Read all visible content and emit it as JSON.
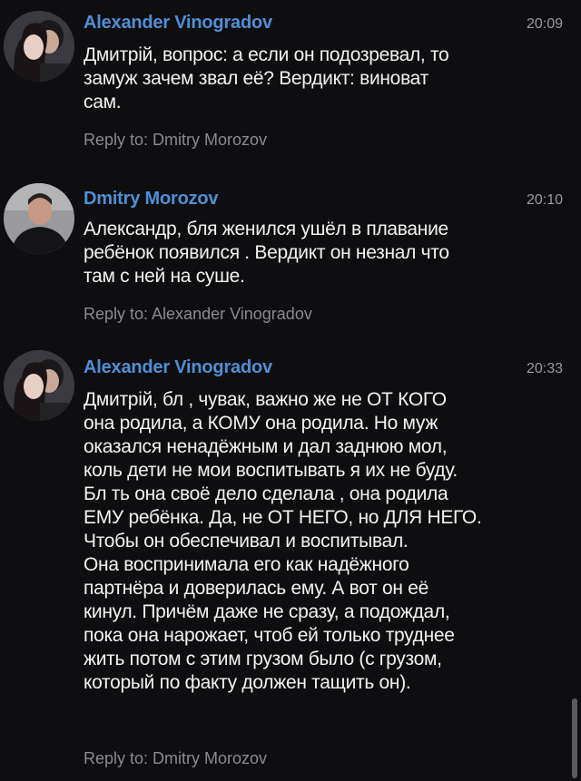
{
  "messages": [
    {
      "author": "Alexander Vinogradov",
      "time": "20:09",
      "avatar_icon": "couple-photo-avatar",
      "lines": [
        "Дмитрій, вопрос: а если он подозревал, то",
        "замуж зачем звал её? Вердикт: виноват",
        "сам."
      ],
      "reply": "Reply to: Dmitry Morozov"
    },
    {
      "author": "Dmitry Morozov",
      "time": "20:10",
      "avatar_icon": "man-photo-avatar",
      "lines": [
        "Александр,  бля женился  ушёл в плавание",
        "ребёнок появился . Вердикт он незнал что",
        "там с ней на суше."
      ],
      "reply": "Reply to: Alexander Vinogradov"
    },
    {
      "author": "Alexander Vinogradov",
      "time": "20:33",
      "avatar_icon": "couple-photo-avatar",
      "lines": [
        "Дмитрій, бл  , чувак, важно же не ОТ КОГО",
        "она родила, а КОМУ она родила. Но муж",
        "оказался ненадёжным и дал заднюю мол,",
        "коль дети не мои воспитывать я их не буду.",
        "Бл   ть она своё дело сделала , она родила",
        "ЕМУ ребёнка. Да, не ОТ НЕГО, но ДЛЯ НЕГО.",
        "Чтобы он обеспечивал и воспитывал.",
        "Она воспринимала его как надёжного",
        "партнёра и доверилась ему. А вот он её",
        "кинул. Причём даже не сразу, а подождал,",
        "пока она нарожает, чтоб ей только труднее",
        "жить потом с этим грузом было (с грузом,",
        "который по факту должен тащить он)."
      ],
      "reply": "Reply to: Dmitry Morozov"
    }
  ],
  "colors": {
    "background": "#0e0e10",
    "author_name": "#4f8fd6",
    "message_text": "#f2f2f2",
    "meta_text": "#8a8a90"
  }
}
